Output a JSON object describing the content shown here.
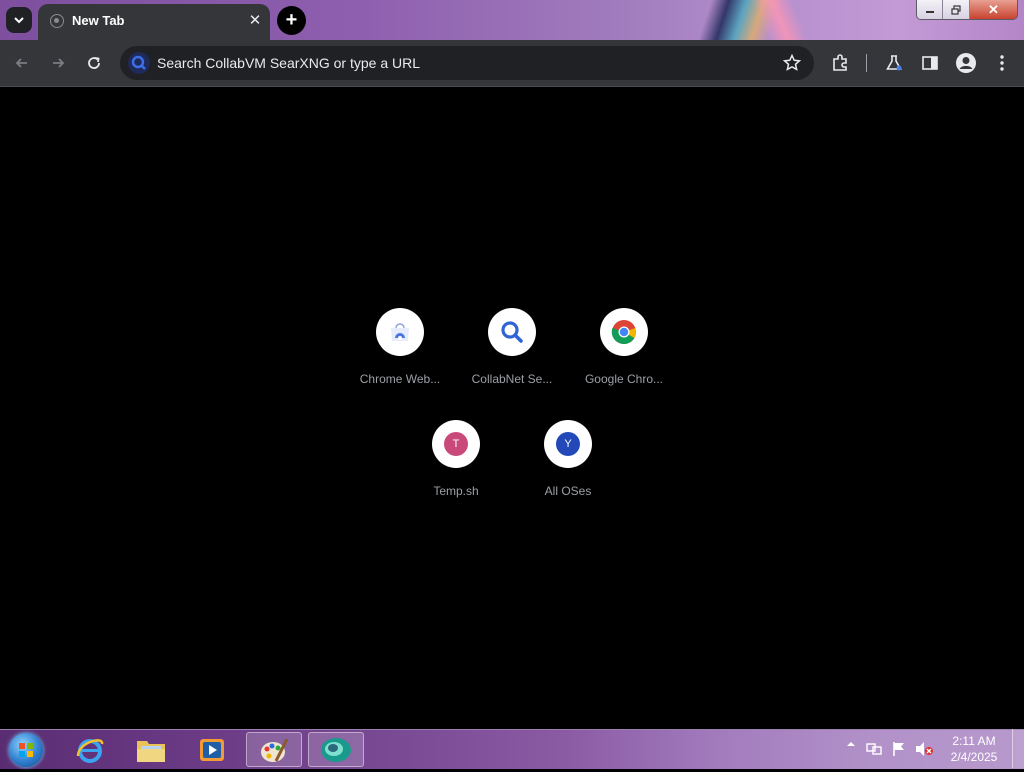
{
  "browser": {
    "tab": {
      "title": "New Tab"
    },
    "omnibox": {
      "placeholder": "Search CollabVM SearXNG or type a URL"
    },
    "window_controls": {
      "close": "✕"
    }
  },
  "shortcuts": [
    {
      "label": "Chrome Web...",
      "icon": "chrome-web-store-icon"
    },
    {
      "label": "CollabNet Se...",
      "icon": "search-magnifier-icon"
    },
    {
      "label": "Google Chro...",
      "icon": "chrome-logo-icon"
    },
    {
      "label": "Temp.sh",
      "letter": "T",
      "color": "#c8497a"
    },
    {
      "label": "All OSes",
      "letter": "Y",
      "color": "#2348b8"
    }
  ],
  "taskbar": {
    "items": [
      "start-orb",
      "internet-explorer-icon",
      "file-explorer-icon",
      "media-player-icon",
      "paint-icon",
      "chromium-icon"
    ],
    "clock": {
      "time": "2:11 AM",
      "date": "2/4/2025"
    }
  }
}
